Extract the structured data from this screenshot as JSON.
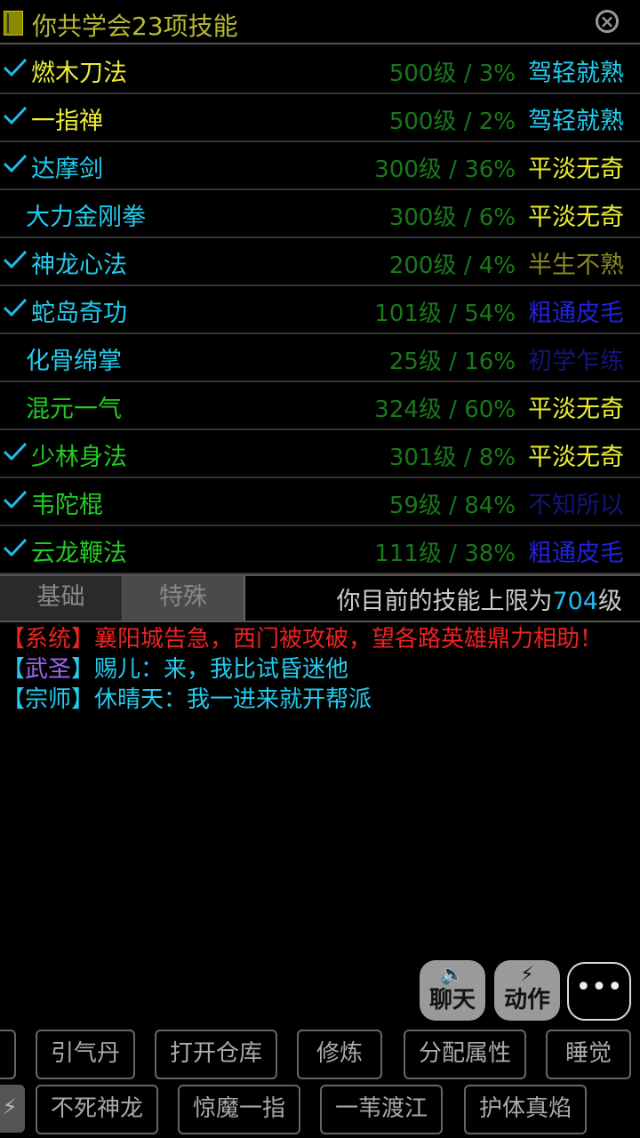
{
  "header": {
    "title": "你共学会23项技能",
    "close_icon": "close-icon",
    "book_icon": "book-icon"
  },
  "skills": [
    {
      "checked": true,
      "name": "燃木刀法",
      "name_color": "#eeee33",
      "meta": "500级 / 3%",
      "rank": "驾轻就熟",
      "rank_color": "#22ccee"
    },
    {
      "checked": true,
      "name": "一指禅",
      "name_color": "#eeee33",
      "meta": "500级 / 2%",
      "rank": "驾轻就熟",
      "rank_color": "#22ccee"
    },
    {
      "checked": true,
      "name": "达摩剑",
      "name_color": "#22ccee",
      "meta": "300级 / 36%",
      "rank": "平淡无奇",
      "rank_color": "#eeee33"
    },
    {
      "checked": false,
      "name": "大力金刚拳",
      "name_color": "#22ccee",
      "meta": "300级 / 6%",
      "rank": "平淡无奇",
      "rank_color": "#eeee33"
    },
    {
      "checked": true,
      "name": "神龙心法",
      "name_color": "#22ccee",
      "meta": "200级 / 4%",
      "rank": "半生不熟",
      "rank_color": "#8a8a22"
    },
    {
      "checked": true,
      "name": "蛇岛奇功",
      "name_color": "#22ccee",
      "meta": "101级 / 54%",
      "rank": "粗通皮毛",
      "rank_color": "#2222dd"
    },
    {
      "checked": false,
      "name": "化骨绵掌",
      "name_color": "#22ccee",
      "meta": "25级 / 16%",
      "rank": "初学乍练",
      "rank_color": "#14147a"
    },
    {
      "checked": false,
      "name": "混元一气",
      "name_color": "#22cc22",
      "meta": "324级 / 60%",
      "rank": "平淡无奇",
      "rank_color": "#eeee33"
    },
    {
      "checked": true,
      "name": "少林身法",
      "name_color": "#22cc22",
      "meta": "301级 / 8%",
      "rank": "平淡无奇",
      "rank_color": "#eeee33"
    },
    {
      "checked": true,
      "name": "韦陀棍",
      "name_color": "#22cc22",
      "meta": "59级 / 84%",
      "rank": "不知所以",
      "rank_color": "#14147a"
    },
    {
      "checked": true,
      "name": "云龙鞭法",
      "name_color": "#22cc22",
      "meta": "111级 / 38%",
      "rank": "粗通皮毛",
      "rank_color": "#2222dd"
    }
  ],
  "tabs": {
    "basic": "基础",
    "special": "特殊"
  },
  "limit": {
    "prefix": "你目前的技能上限为",
    "value": "704",
    "suffix": "级"
  },
  "chat": [
    {
      "tag": "【系统】",
      "tag_color": "#ee2222",
      "text": "襄阳城告急，西门被攻破，望各路英雄鼎力相助！",
      "text_color": "#ee2222",
      "bracket_color": "#ee2222"
    },
    {
      "tag": "武圣",
      "tag_color": "#9966ee",
      "text": "赐儿：来，我比试昏迷他",
      "text_color": "#22ccee",
      "bracket_color": "#22ccee",
      "bracketed": true
    },
    {
      "tag": "宗师",
      "tag_color": "#22ccee",
      "text": "休晴天：我一进来就开帮派",
      "text_color": "#22ccee",
      "bracket_color": "#22ccee",
      "bracketed": true
    }
  ],
  "actions": {
    "chat_label": "聊天",
    "chat_icon": "speaker-icon",
    "action_label": "动作",
    "action_icon": "lightning-icon",
    "more_icon": "more-icon"
  },
  "quick_row1": [
    "引气丹",
    "打开仓库",
    "修炼",
    "分配属性",
    "睡觉"
  ],
  "quick_row2": [
    "不死神龙",
    "惊魔一指",
    "一苇渡江",
    "护体真焰"
  ]
}
